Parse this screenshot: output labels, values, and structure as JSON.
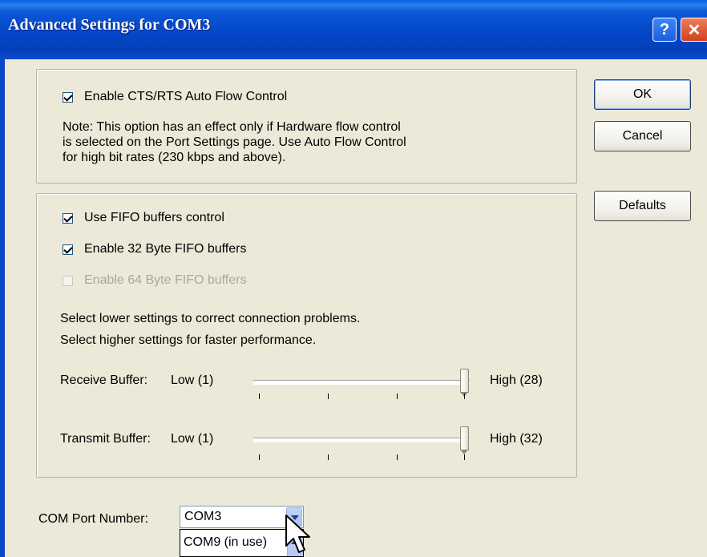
{
  "window": {
    "title": "Advanced Settings for COM3",
    "help_label": "?",
    "close_label": "✕"
  },
  "flow": {
    "checkbox_label": "Enable CTS/RTS Auto Flow Control",
    "checked": true,
    "note_lines": [
      "Note: This option has an effect only if Hardware flow control",
      "is selected on the Port Settings page. Use Auto Flow Control",
      "for high bit rates (230 kbps and above)."
    ]
  },
  "fifo": {
    "use_fifo": {
      "label": "Use FIFO buffers control",
      "checked": true
    },
    "enable32": {
      "label": "Enable 32 Byte FIFO buffers",
      "checked": true
    },
    "enable64": {
      "label": "Enable 64 Byte FIFO buffers",
      "checked": false,
      "disabled": true
    },
    "hint_lines": [
      "Select lower settings to correct connection problems.",
      "Select higher settings for faster performance."
    ],
    "receive": {
      "label": "Receive Buffer:",
      "low": "Low (1)",
      "high": "High (28)",
      "value": 28,
      "max": 28
    },
    "transmit": {
      "label": "Transmit Buffer:",
      "low": "Low (1)",
      "high": "High (32)",
      "value": 32,
      "max": 32
    }
  },
  "buttons": {
    "ok": "OK",
    "cancel": "Cancel",
    "defaults": "Defaults"
  },
  "com_port": {
    "label": "COM Port Number:",
    "selected": "COM3",
    "options_visible": [
      "COM9 (in use)"
    ]
  },
  "colors": {
    "title_bar": "#0446c8",
    "dialog_bg": "#ece9d8",
    "close_red": "#d2411e"
  }
}
